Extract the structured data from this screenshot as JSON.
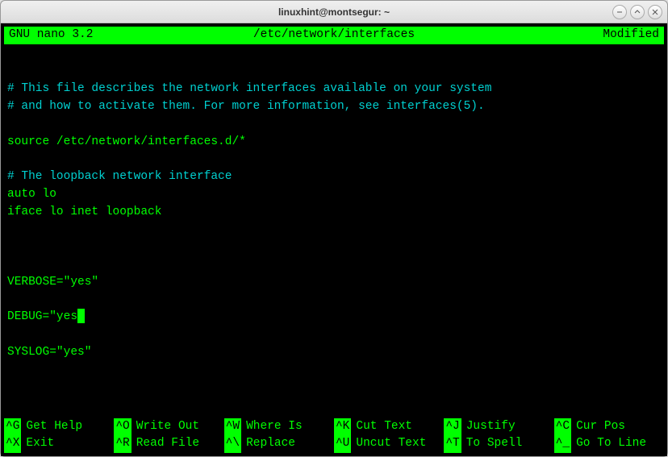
{
  "window": {
    "title": "linuxhint@montsegur: ~"
  },
  "nano": {
    "app": "GNU nano 3.2",
    "filename": "/etc/network/interfaces",
    "status": "Modified"
  },
  "content": {
    "line1": "# This file describes the network interfaces available on your system",
    "line2": "# and how to activate them. For more information, see interfaces(5).",
    "line3": "",
    "line4": "source /etc/network/interfaces.d/*",
    "line5": "",
    "line6": "# The loopback network interface",
    "line7": "auto lo",
    "line8": "iface lo inet loopback",
    "line9": "",
    "line10": "",
    "line11": "",
    "line12": "VERBOSE=\"yes\"",
    "line13": "",
    "line14": "DEBUG=\"yes",
    "line15": "",
    "line16": "SYSLOG=\"yes\""
  },
  "shortcuts": [
    {
      "key": "^G",
      "label": "Get Help"
    },
    {
      "key": "^O",
      "label": "Write Out"
    },
    {
      "key": "^W",
      "label": "Where Is"
    },
    {
      "key": "^K",
      "label": "Cut Text"
    },
    {
      "key": "^J",
      "label": "Justify"
    },
    {
      "key": "^C",
      "label": "Cur Pos"
    },
    {
      "key": "^X",
      "label": "Exit"
    },
    {
      "key": "^R",
      "label": "Read File"
    },
    {
      "key": "^\\",
      "label": "Replace"
    },
    {
      "key": "^U",
      "label": "Uncut Text"
    },
    {
      "key": "^T",
      "label": "To Spell"
    },
    {
      "key": "^_",
      "label": "Go To Line"
    }
  ]
}
